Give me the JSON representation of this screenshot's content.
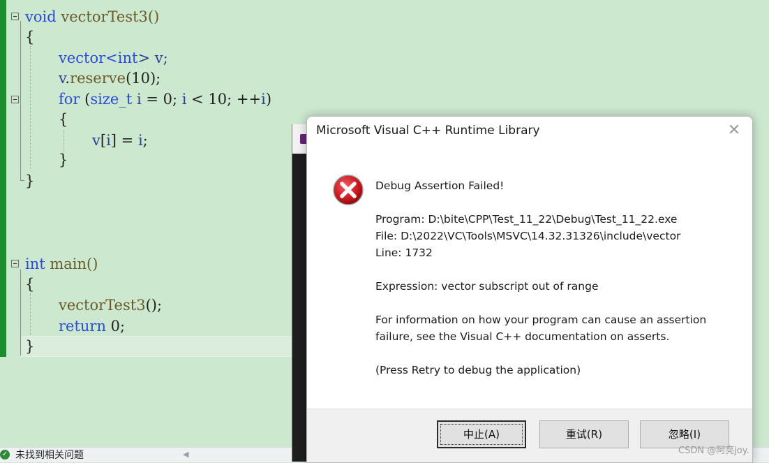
{
  "editor": {
    "lines": {
      "l1_kw": "void",
      "l1_name": " vectorTest3()",
      "l2": "{",
      "l3_type": "vector<",
      "l3_kw": "int",
      "l3_rest": "> v;",
      "l4_obj": "v",
      "l4_dot": ".",
      "l4_fn": "reserve",
      "l4_rest": "(10);",
      "l5_kw": "for",
      "l5_p1": " (",
      "l5_type": "size_t",
      "l5_sp": " ",
      "l5_i1": "i",
      "l5_mid1": " = 0; ",
      "l5_i2": "i",
      "l5_mid2": " < 10; ++",
      "l5_i3": "i",
      "l5_end": ")",
      "l6": "{",
      "l7_v": "v",
      "l7_b1": "[",
      "l7_i": "i",
      "l7_b2": "] = ",
      "l7_i2": "i",
      "l7_end": ";",
      "l8": "}",
      "l9": "}",
      "l10_kw": "int",
      "l10_name": " main()",
      "l11": "{",
      "l12_fn": "vectorTest3",
      "l12_rest": "();",
      "l13_kw": "return",
      "l13_rest": " 0;",
      "l14": "}"
    }
  },
  "status": {
    "text": "未找到相关问题",
    "ok_icon": "check-circle-icon",
    "scroll_glyph": "◀"
  },
  "dialog": {
    "title": "Microsoft Visual C++ Runtime Library",
    "close_glyph": "✕",
    "icon": "error-x-icon",
    "heading": "Debug Assertion Failed!",
    "program": "Program: D:\\bite\\CPP\\Test_11_22\\Debug\\Test_11_22.exe",
    "file": "File: D:\\2022\\VC\\Tools\\MSVC\\14.32.31326\\include\\vector",
    "line": "Line: 1732",
    "expression": "Expression: vector subscript out of range",
    "info1": "For information on how your program can cause an assertion",
    "info2": "failure, see the Visual C++ documentation on asserts.",
    "press": "(Press Retry to debug the application)",
    "buttons": {
      "abort": "中止(A)",
      "retry": "重试(R)",
      "ignore": "忽略(I)"
    }
  },
  "watermark": "CSDN @阿亮joy.",
  "colors": {
    "editor_bg": "#cce8cf",
    "change_bar": "#1b8d2c",
    "keyword": "#2b4bd8",
    "error_red": "#c8161d"
  }
}
